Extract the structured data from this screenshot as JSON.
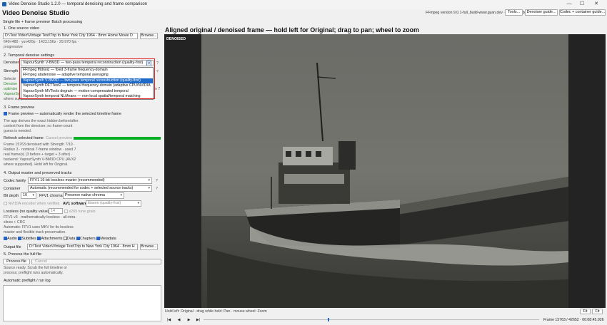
{
  "window": {
    "title": "Video Denoise Studio 1.2.0 — temporal denoising and frame comparison",
    "controls": [
      "—",
      "☐",
      "✕"
    ]
  },
  "app": {
    "heading": "Video Denoise Studio"
  },
  "header_right": {
    "ffmpeg_info": "FFmpeg version 9.0.1-full_build-www.gyan.dev · R79 · 6/6 denoisers ready",
    "tools_label": "Tools...",
    "guide_label": "Denoiser guide...",
    "codec_guide_label": "Codec + container guide..."
  },
  "mode_tabs": {
    "single": "Single file + frame preview",
    "batch": "Batch processing"
  },
  "source": {
    "section": "1. One source video",
    "path": "D:\\Test Video\\Vintage Test\\Trip to New York City 1964 - 8mm Home Movie D",
    "browse_label": "Browse...",
    "info_line1": "640×480 · yuv420p · 1423.156s · 29.970 fps ·",
    "info_line2": "progressive"
  },
  "settings": {
    "section": "2. Temporal denoise settings",
    "denoiser_label": "Denoiser",
    "denoiser_value": "VapourSynth V-BM3D — two-pass temporal reconstruction (quality-first)",
    "help_label": "?",
    "strength_label": "Strength",
    "note_fragments": [
      "Selecte",
      "Denoise",
      "optimize",
      "VapourSy",
      "where supported."
    ],
    "note_right": "n 7",
    "options": [
      {
        "label": "FFmpeg fftdnoiz — fixed 3-frame frequency-domain",
        "selected": false
      },
      {
        "label": "FFmpeg atadenoise — adaptive temporal averaging",
        "selected": false
      },
      {
        "label": "VapourSynth V-BM3D — two-pass temporal reconstruction (quality-first)",
        "selected": true
      },
      {
        "label": "VapourSynth DFTTest2 — temporal frequency-domain (adaptive CPU/NVIDIA",
        "selected": false
      },
      {
        "label": "VapourSynth MVTools degrain — motion-compensated temporal",
        "selected": false
      },
      {
        "label": "VapourSynth temporal NLMeans — non-local spatial/temporal matching",
        "selected": false
      }
    ]
  },
  "preview": {
    "section": "3. Frame preview",
    "auto_label": "Frame preview — automatically render the selected timeline frame",
    "auto_checked": true,
    "explain": [
      "The app derives the exact hidden before/after",
      "context from the denoiser; no frame-count",
      "guess is needed."
    ],
    "refresh_label": "Refresh selected frame",
    "cancel_label": "Cancel preview",
    "progress_fraction": 1.0,
    "result": [
      "Frame 15763 denoised with Strength 7/10 ·",
      "Radius 3 · nominal 7-frame window · used 7",
      "real frame(s) (3 before + target + 3 after) ·",
      "backend: VapourSynth V-BM3D CPU (AVX2",
      "where supported). Hold left for Original."
    ]
  },
  "output": {
    "section": "4. Output master and preserved tracks",
    "codec_family_label": "Codec family",
    "codec_family_value": "FFV1 16-bit lossless master (recommended)",
    "container_label": "Container",
    "container_value": "Automatic (recommended for codec + selected source tracks)",
    "bit_depth_label": "Bit depth",
    "bit_depth_value": "10",
    "ffv1_chroma_label": "FFV1 chroma",
    "ffv1_chroma_value": "Preserve native chroma",
    "nvidia_label": "NVIDIA encoder when verified",
    "av1_label": "AV1 software",
    "av1_value": "libaom (quality-first)",
    "lossless_label": "Lossless (no quality value)",
    "lossless_value": "14",
    "x265_label": "x265 tune grain",
    "ffv1_notes": [
      "FFV1 v3 · mathematically lossless · all-intra ·",
      "slices + CRC",
      "Automatic: FFV1 uses MKV for its lossless",
      "master and flexible track preservation."
    ],
    "tracks": [
      {
        "label": "Audio",
        "checked": true
      },
      {
        "label": "Subtitles",
        "checked": true
      },
      {
        "label": "Attachments",
        "checked": true
      },
      {
        "label": "Data",
        "checked": false
      },
      {
        "label": "Chapters",
        "checked": true
      },
      {
        "label": "Metadata",
        "checked": true
      }
    ],
    "output_file_label": "Output file",
    "output_path": "D:\\Test Video\\Vintage Test\\Trip to New York City 1964 - 8mm H",
    "browse_label": "Browse..."
  },
  "process": {
    "section": "5. Process the full file",
    "process_label": "Process file",
    "cancel_label": "Cancel",
    "status": [
      "Source ready. Scrub the full timeline or",
      "process; preflight runs automatically."
    ],
    "log_label": "Automatic preflight / run log"
  },
  "viewer": {
    "title": "Aligned original / denoised frame — hold left for Original; drag to pan; wheel to zoom",
    "frame_tag": "DENOISED",
    "status": "Hold left: Original · drag while held: Pan · mouse wheel: Zoom",
    "fit1": "Fit",
    "fit2": "Fit",
    "player_buttons": [
      "|◀",
      "◀",
      "▶",
      "▶|"
    ],
    "seek_fraction": 0.37,
    "frame_text": "Frame 15763 / 42652 · 00:08:45.926"
  }
}
